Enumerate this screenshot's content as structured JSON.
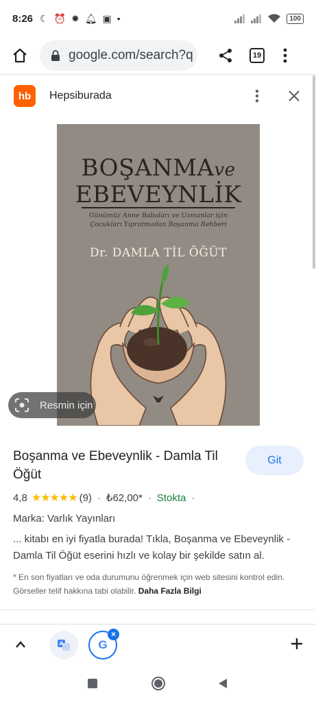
{
  "status_bar": {
    "time": "8:26",
    "battery": "100",
    "left_icons": [
      "moon-icon",
      "alarm-icon",
      "bug-icon",
      "bell-icon",
      "calendar-icon",
      "dot-icon"
    ],
    "right_icons": [
      "signal-icon",
      "signal-icon",
      "wifi-icon",
      "battery-icon"
    ]
  },
  "browser": {
    "url": "google.com/search?q",
    "tab_count": "19"
  },
  "source": {
    "logo_text": "hb",
    "name": "Hepsiburada"
  },
  "cover": {
    "title_line1": "BOŞANMA",
    "title_ve": "ve",
    "title_line2": "EBEVEYNLİK",
    "subtitle_line1": "Günümüz Anne Babaları ve Uzmanlar için",
    "subtitle_line2": "Çocukları Yıpratmadan Boşanma Rehberi",
    "author": "Dr. DAMLA TİL ÖĞÜT"
  },
  "lens": {
    "label": "Resmin için"
  },
  "product": {
    "title": "Boşanma ve Ebeveynlik - Damla Til Öğüt",
    "go_label": "Git",
    "rating": "4,8",
    "stars": "★★★★★",
    "review_count": "(9)",
    "price": "₺62,00*",
    "stock": "Stokta",
    "brand": "Marka: Varlık Yayınları",
    "description": "... kitabı en iyi fiyatla burada! Tıkla, Boşanma ve Ebeveynlik - Damla Til Öğüt eserini hızlı ve kolay bir şekilde satın al.",
    "disclaimer": "* En son fiyatları ve oda durumunu öğrenmek için web sitesini kontrol edin. Görseller telif hakkına tabi olabilir.",
    "more_info": "Daha Fazla Bilgi"
  },
  "bottom_bar": {
    "google_letter": "G",
    "close_badge": "×"
  },
  "colors": {
    "accent": "#1a73e8",
    "stock_green": "#188038",
    "star_yellow": "#fbbc04",
    "brand_orange": "#ff6000",
    "cover_bg": "#928b83"
  }
}
